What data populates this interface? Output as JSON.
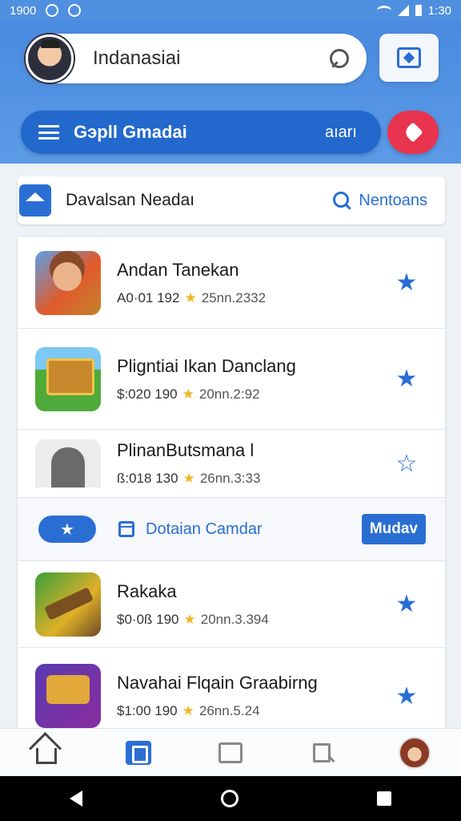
{
  "status_bar": {
    "time_left": "1900",
    "time_right": "1:30"
  },
  "header": {
    "search_text": "Indanasiai",
    "nav_title": "Gэрll Gmadai",
    "nav_right": "aıarı"
  },
  "section": {
    "title": "Davalsan Neadaı",
    "link": "Nentoans"
  },
  "apps": [
    {
      "title": "Andan Tanekan",
      "price": "A0·01 192",
      "date": "25nn.2332",
      "starred": true
    },
    {
      "title": "Pligntiai Ikan Danclang",
      "price": "$:020 190",
      "date": "20nn.2:92",
      "starred": true
    },
    {
      "title": "PlinanButsmana l",
      "price": "ß:018 130",
      "date": "26nn.3:33",
      "starred": false
    },
    {
      "title": "Rakaka",
      "price": "$0·0ß 190",
      "date": "20nn.3.394",
      "starred": true
    },
    {
      "title": "Navahai Flqain Graabirng",
      "price": "$1:00 190",
      "date": "26nn.5.24",
      "starred": true
    }
  ],
  "filter": {
    "text": "Dotaian Camdar",
    "button": "Mudav",
    "pill_icon": "★"
  },
  "icons": {
    "star": "★",
    "star_outline": "☆",
    "small_star": "★"
  }
}
